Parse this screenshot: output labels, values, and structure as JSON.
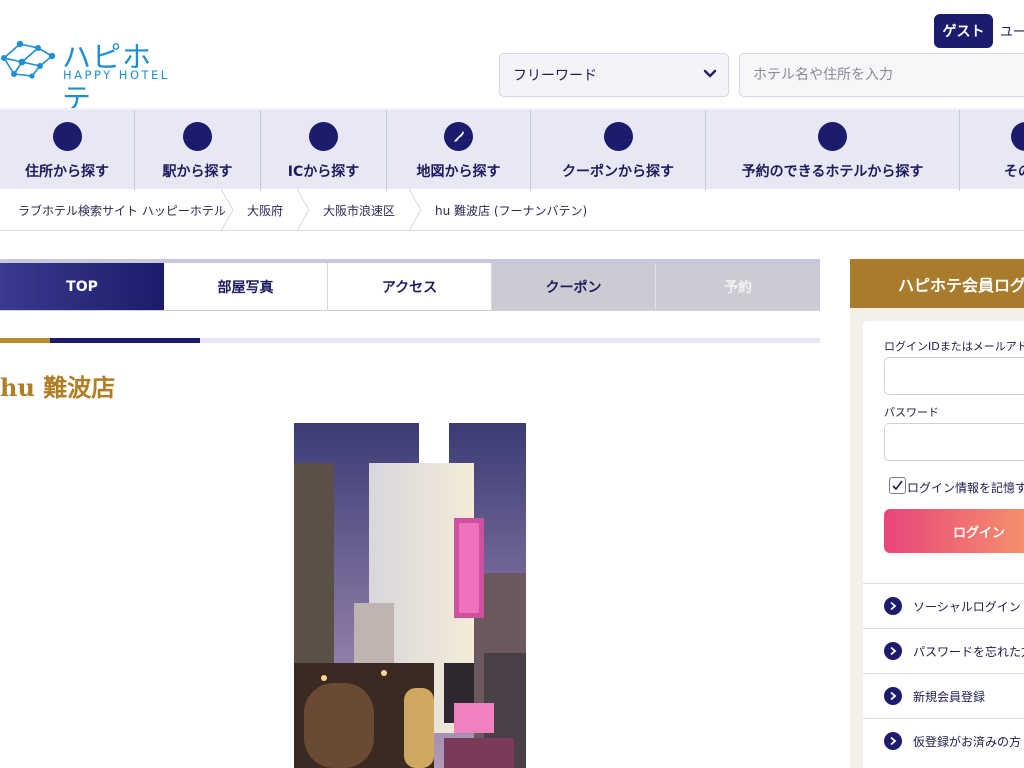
{
  "header": {
    "logo_main": "ハピホテ",
    "logo_sub": "HAPPY HOTEL",
    "guest_badge": "ゲスト",
    "user_text": "ユー",
    "freeword_label": "フリーワード",
    "search_placeholder": "ホテル名や住所を入力"
  },
  "nav": {
    "items": [
      {
        "label": "住所から探す"
      },
      {
        "label": "駅から探す"
      },
      {
        "label": "ICから探す"
      },
      {
        "label": "地図から探す"
      },
      {
        "label": "クーポンから探す"
      },
      {
        "label": "予約のできるホテルから探す"
      },
      {
        "label": "その他"
      }
    ]
  },
  "breadcrumb": {
    "items": [
      "ラブホテル検索サイト ハッピーホテル",
      "大阪府",
      "大阪市浪速区",
      "hu 難波店 (フーナンバテン)"
    ]
  },
  "tabs": {
    "items": [
      "TOP",
      "部屋写真",
      "アクセス",
      "クーポン",
      "予約"
    ]
  },
  "hotel": {
    "title": "hu 難波店"
  },
  "login": {
    "header": "ハピホテ会員ログ",
    "id_label": "ログインIDまたはメールアドレ",
    "password_label": "パスワード",
    "remember_label": "ログイン情報を記憶す",
    "login_button": "ログイン",
    "links": [
      "ソーシャルログイン",
      "パスワードを忘れた方",
      "新規会員登録",
      "仮登録がお済みの方"
    ]
  },
  "colors": {
    "navy": "#1c1c6e",
    "gold": "#b07e24",
    "nav_bg": "#e8e8f4",
    "login_gradient_start": "#e8457a",
    "login_gradient_end": "#f79a6a"
  }
}
